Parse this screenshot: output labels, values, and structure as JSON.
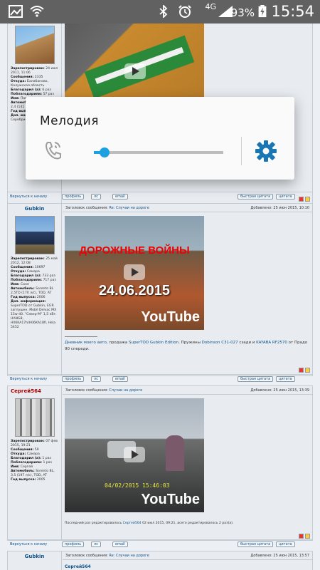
{
  "status": {
    "network": "4G",
    "battery": "93%",
    "time": "15:54"
  },
  "dialog": {
    "title": "Мелодия",
    "volume_level": 0.08
  },
  "post1": {
    "joined": "24 июл 2011, 11:06",
    "messages": "2335",
    "location": "Балабаново, Калужская область",
    "thanked": "6 раз",
    "thanked_by": "57 раз",
    "name": "Павел",
    "car": "Sorento BL 2,4 (141 л/с), 2008, ...",
    "info_tail": "Серебристый, ...",
    "back_link": "Вернуться к началу",
    "btn_profile": "профиль",
    "btn_ls": "лс",
    "btn_email": "email",
    "btn_quick": "быстрая цитата",
    "btn_quote": "цитата"
  },
  "post2": {
    "author": "Gubkin",
    "header": "Заголовок сообщения:",
    "subject": "Re: Случаи на дороге",
    "date": "Добавлено: 25 июн 2015, 10:10",
    "video_title": "ДОРОЖНЫЕ ВОЙНЫ",
    "video_date": "24.06.2015",
    "youtube": "YouTube",
    "joined": "25 май 2012, 12:08",
    "messages": "10697",
    "location": "Самара",
    "thanked": "733 раз",
    "thanked_by": "717 раз",
    "name": "Саня",
    "car": "Sorento BL 2,5TD (170 л/с), TOD, AT",
    "year": "2006",
    "extra": "SuperTOD от Gubkin, EGR заглушен. Mobil Delvac MX 15w-40. \"Север-М\" 1,5 кВт. HANG8, H06KA17h/H06KA18fi, Hela 5452",
    "sig_diary": "Дневник моего авто",
    "sig_sale": ", продажа ",
    "sig_supertod": "SuperTOD Gubkin Edition",
    "sig_springs": ". Пружины ",
    "sig_dobinson": "Dobinson C31-027",
    "sig_rear": " сзади и ",
    "sig_kayaba": "KAYABA RF2570",
    "sig_end": " от Прадо 90 спереди.",
    "back_link": "Вернуться к началу",
    "btn_profile": "профиль",
    "btn_ls": "лс",
    "btn_email": "email",
    "btn_quick": "быстрая цитата",
    "btn_quote": "цитата"
  },
  "post3": {
    "author": "Сергей564",
    "header": "Заголовок сообщения:",
    "subject": "Случаи на дороге",
    "date": "Добавлено: 25 июн 2015, 13:39",
    "video_date": "04/02/2015 15:46:03",
    "youtube": "YouTube",
    "joined": "07 фев 2015, 19:21",
    "messages": "59",
    "location": "Самара",
    "thanked": "1 раз",
    "thanked_by": "1 раз",
    "name": "Сергей",
    "car": "Sorento BL, 3.5 (197 л/с), TOD, AT",
    "year": "2005",
    "edited_prefix": "Последний раз редактировалось ",
    "edited_user": "Сергей564",
    "edited_suffix": " 02 июл 2015, 09:21, всего редактировалось 2 раз(а).",
    "back_link": "Вернуться к началу",
    "btn_profile": "профиль",
    "btn_ls": "лс",
    "btn_email": "email",
    "btn_quick": "быстрая цитата",
    "btn_quote": "цитата"
  },
  "post4": {
    "author": "Gubkin",
    "header": "Заголовок сообщения:",
    "subject": "Re: Случаи на дороге",
    "date": "Добавлено: 25 июн 2015, 13:57",
    "quote_author": "Сергей564"
  },
  "labels": {
    "joined": "Зарегистрирован:",
    "messages": "Сообщения:",
    "location": "Откуда:",
    "thanked": "Благодарил (а):",
    "thanked_by": "Поблагодарили:",
    "name": "Имя:",
    "car": "Автомобиль:",
    "year": "Год выпуска:",
    "extra": "Доп. информация:"
  }
}
